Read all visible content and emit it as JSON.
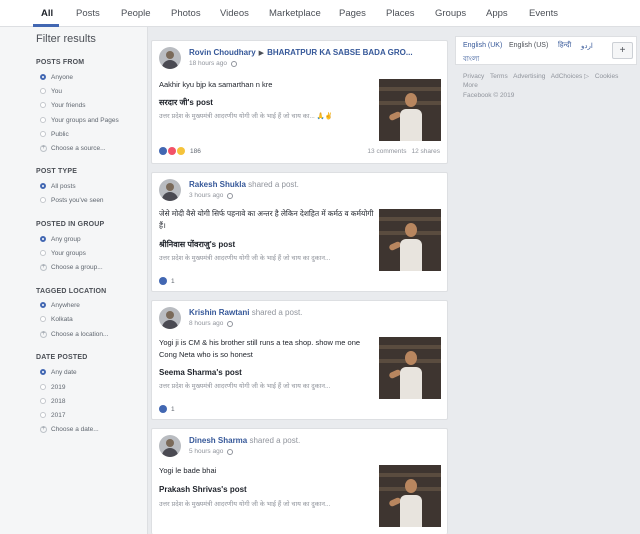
{
  "tabs": [
    "All",
    "Posts",
    "People",
    "Photos",
    "Videos",
    "Marketplace",
    "Pages",
    "Places",
    "Groups",
    "Apps",
    "Events"
  ],
  "sidebar": {
    "title": "Filter results",
    "posts_from": {
      "title": "POSTS FROM",
      "options": [
        "Anyone",
        "You",
        "Your friends",
        "Your groups and Pages",
        "Public"
      ],
      "selected": "Anyone",
      "choose": "Choose a source..."
    },
    "post_type": {
      "title": "POST TYPE",
      "options": [
        "All posts",
        "Posts you've seen"
      ],
      "selected": "All posts"
    },
    "posted_in_group": {
      "title": "POSTED IN GROUP",
      "options": [
        "Any group",
        "Your groups"
      ],
      "selected": "Any group",
      "choose": "Choose a group..."
    },
    "tagged_location": {
      "title": "TAGGED LOCATION",
      "options": [
        "Anywhere",
        "Kolkata"
      ],
      "selected": "Anywhere",
      "choose": "Choose a location..."
    },
    "date_posted": {
      "title": "DATE POSTED",
      "options": [
        "Any date",
        "2019",
        "2018",
        "2017"
      ],
      "selected": "Any date",
      "choose": "Choose a date..."
    }
  },
  "posts": [
    {
      "author": "Rovin Choudhary",
      "arrow": "▶",
      "group": "BHARATPUR KA SABSE BADA GRO...",
      "time": "18 hours ago",
      "text": "Aakhir kyu bjp ka samarthan n kre",
      "shared_title": "सरदार जी's post",
      "shared_sub": "उत्तर प्रदेश के मुख्यमंत्री आदरणीय योगी जी के भाई हैं जो चाय का... 🙏✌",
      "react_count": "186",
      "comments": "13 comments",
      "shares": "12 shares"
    },
    {
      "author": "Rakesh Shukla",
      "shared_label": "shared a post.",
      "time": "3 hours ago",
      "text": "जेसे मोदी वैसे योगी सिर्फ पहनावे का अन्तर है लेकिन देशहित में कर्मठ व कर्मयोगी हैं।",
      "shared_title": "श्रीनिवास पोंवराजु's post",
      "shared_sub": "उत्तर प्रदेश के मुख्यमंत्री आदरणीय योगी जी के भाई हैं जो चाय का दुकान...",
      "react_count": "1"
    },
    {
      "author": "Krishin Rawtani",
      "shared_label": "shared a post.",
      "time": "8 hours ago",
      "text": "Yogi ji is CM & his brother still runs a tea shop.  show me one Cong Neta who is so honest",
      "shared_title": "Seema Sharma's post",
      "shared_sub": "उत्तर प्रदेश के मुख्यमंत्री आदरणीय योगी जी के भाई हैं जो चाय का दुकान...",
      "react_count": "1"
    },
    {
      "author": "Dinesh Sharma",
      "shared_label": "shared a post.",
      "time": "5 hours ago",
      "text": "Yogi le bade bhai",
      "shared_title": "Prakash Shrivas's post",
      "shared_sub": "उत्तर प्रदेश के मुख्यमंत्री आदरणीय योगी जी के भाई हैं जो चाय का दुकान..."
    }
  ],
  "right": {
    "languages": [
      "English (UK)",
      "English (US)",
      "हिन्दी",
      "اردو",
      "বাংলা"
    ],
    "add_button": "+",
    "footer_links": [
      "Privacy",
      "Terms",
      "Advertising",
      "AdChoices ▷",
      "Cookies",
      "More"
    ],
    "copyright": "Facebook © 2019"
  },
  "colors": {
    "brand_blue": "#4267b2",
    "link_blue": "#365899",
    "page_bg": "#e9ebee"
  },
  "icons": [
    "globe-icon",
    "like-reaction-icon",
    "love-reaction-icon",
    "wow-reaction-icon",
    "plus-icon"
  ]
}
